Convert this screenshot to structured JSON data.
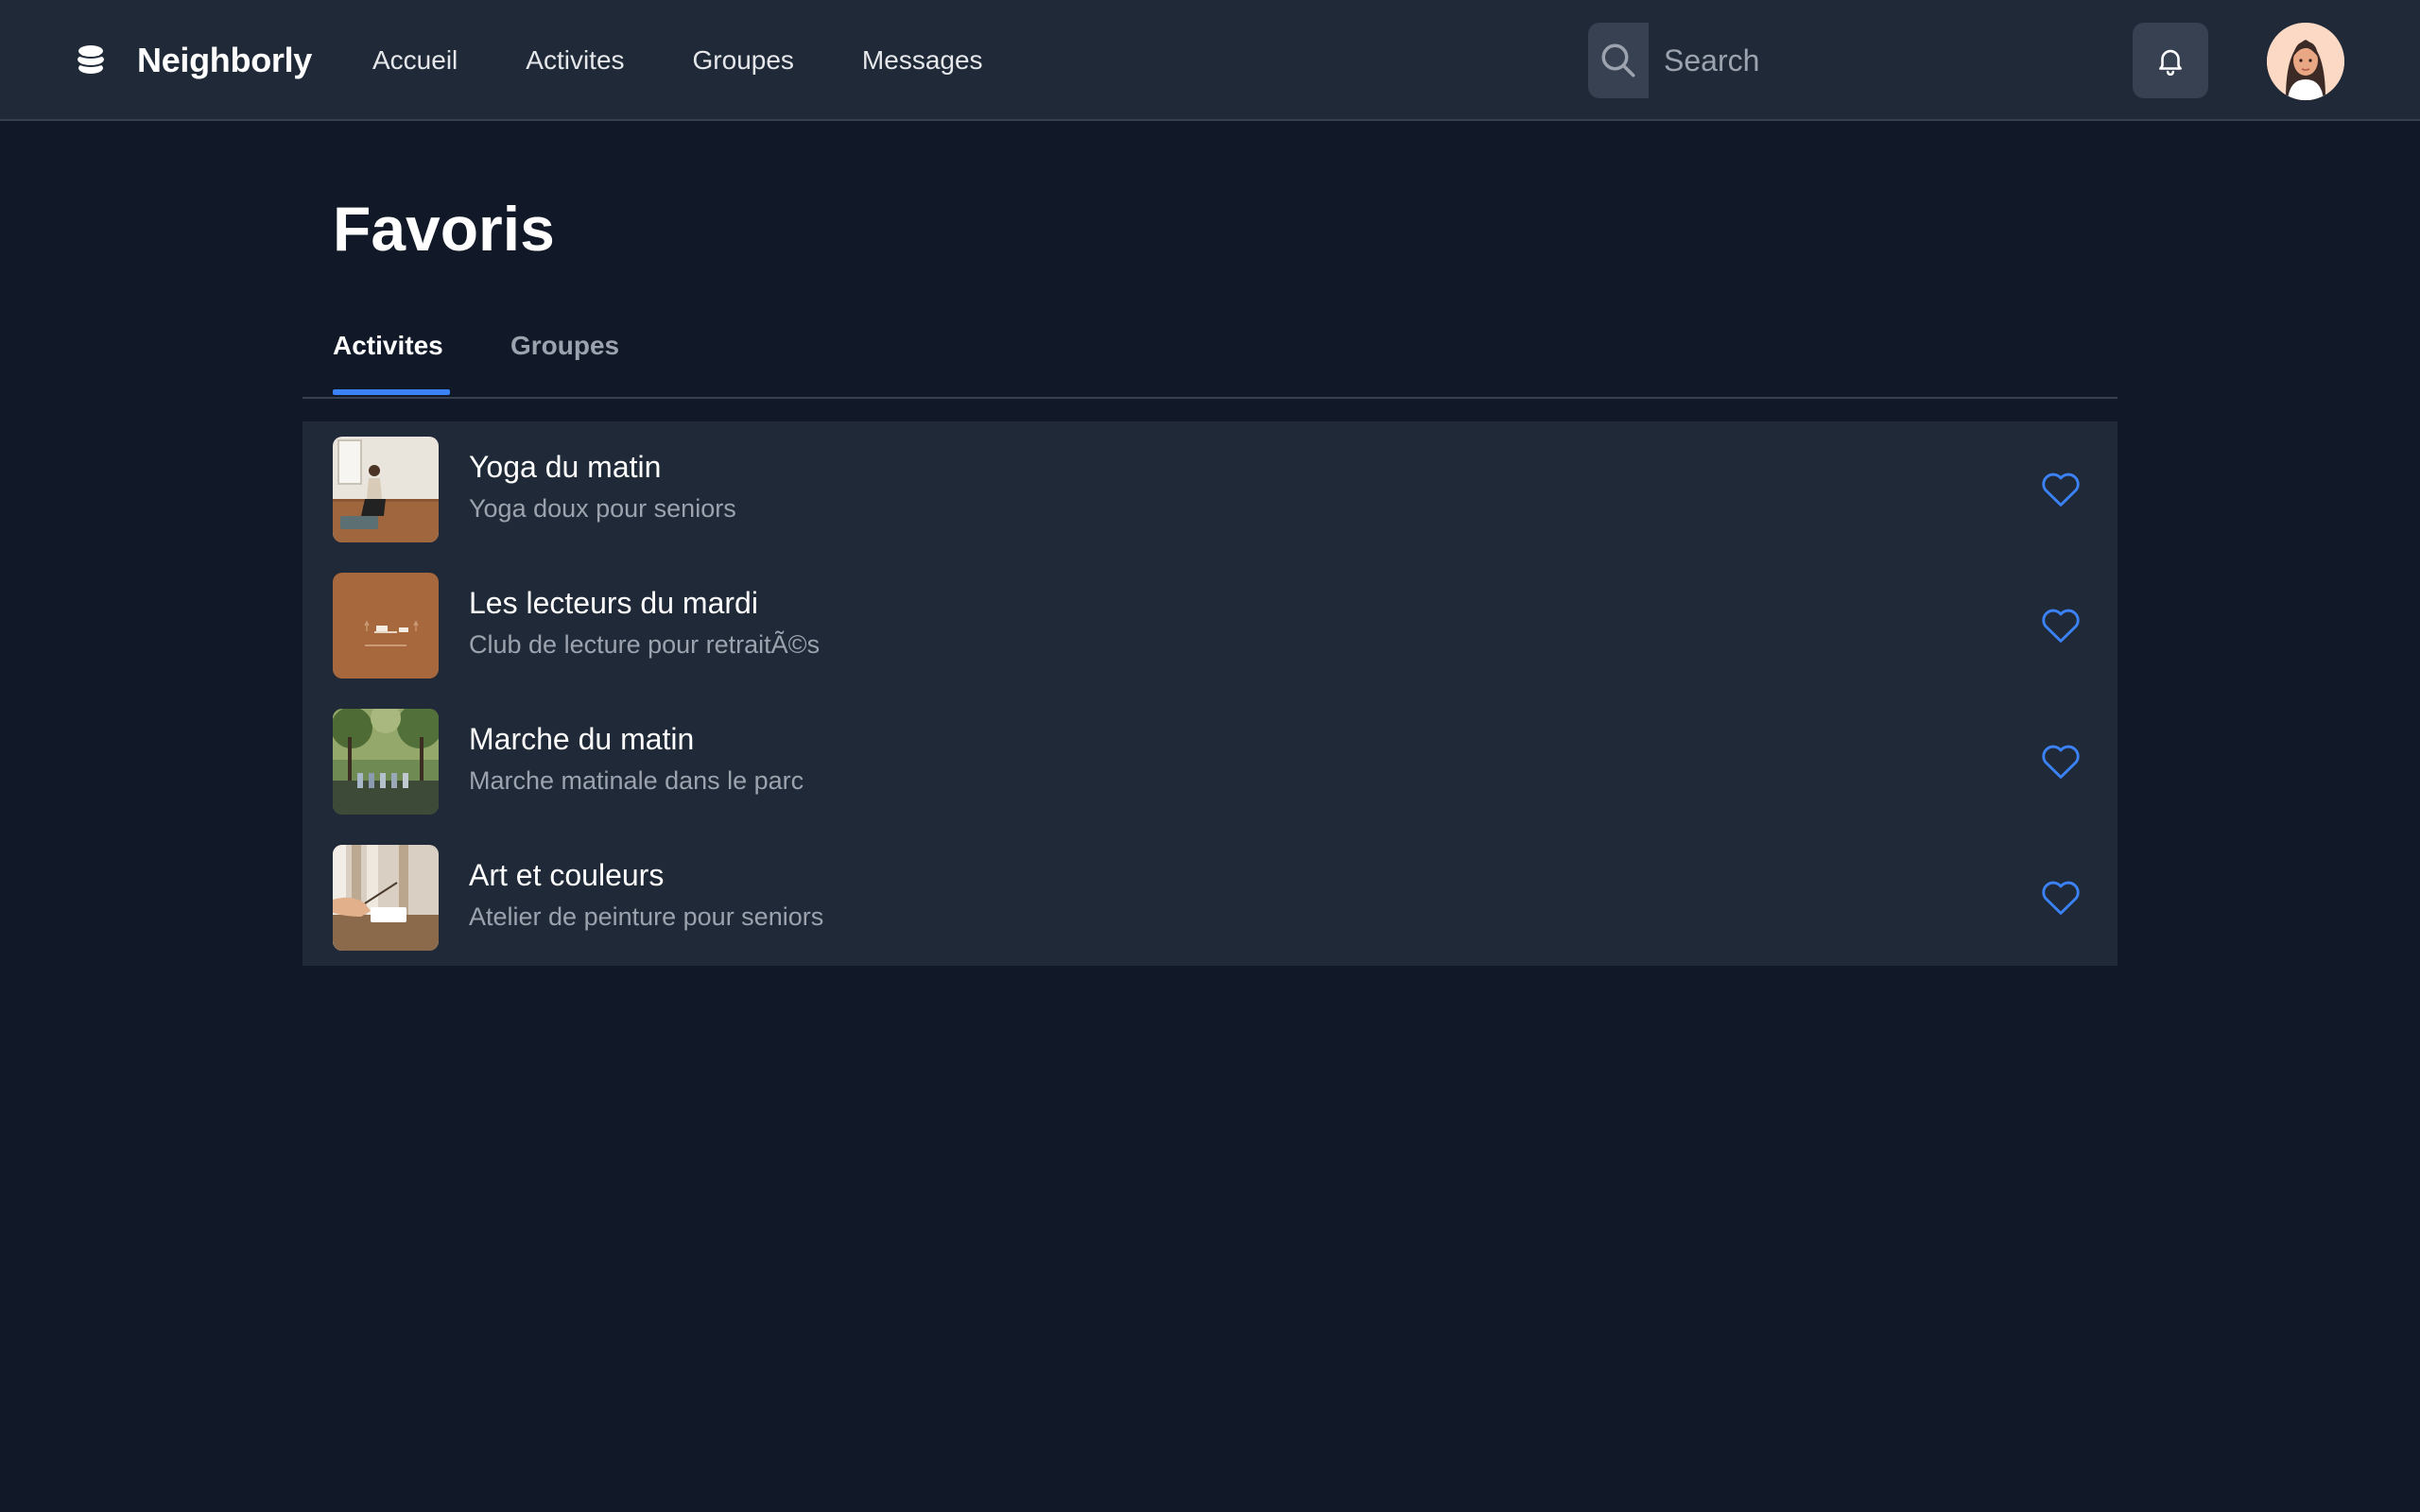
{
  "header": {
    "brand": "Neighborly",
    "nav": [
      "Accueil",
      "Activites",
      "Groupes",
      "Messages"
    ],
    "search_placeholder": "Search"
  },
  "main": {
    "title": "Favoris",
    "tabs": [
      {
        "label": "Activites",
        "active": true
      },
      {
        "label": "Groupes",
        "active": false
      }
    ],
    "items": [
      {
        "title": "Yoga du matin",
        "subtitle": "Yoga doux pour seniors",
        "favorited": true
      },
      {
        "title": "Les lecteurs du mardi",
        "subtitle": "Club de lecture pour retraitÃ©s",
        "favorited": true
      },
      {
        "title": "Marche du matin",
        "subtitle": "Marche matinale dans le parc",
        "favorited": true
      },
      {
        "title": "Art et couleurs",
        "subtitle": "Atelier de peinture pour seniors",
        "favorited": true
      }
    ]
  },
  "colors": {
    "background": "#111827",
    "header": "#1f2937",
    "panel": "#1f2937",
    "accent": "#3b82f6",
    "muted_text": "#9ca3af"
  },
  "icons": [
    "logo-icon",
    "search-icon",
    "bell-icon",
    "heart-icon"
  ]
}
